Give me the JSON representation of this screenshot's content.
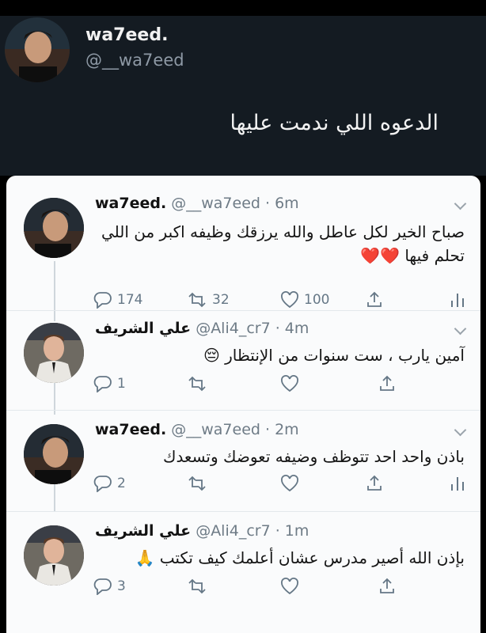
{
  "top": {
    "name": "wa7eed.",
    "handle": "@__wa7eed",
    "text": "الدعوه اللي ندمت عليها"
  },
  "tweets": [
    {
      "name": "wa7eed.",
      "handle": "@__wa7eed · 6m",
      "text": "صباح الخير لكل عاطل والله يرزقك وظيفه  اكبر من اللي تحلم فيها ❤️❤️",
      "reply_count": "174",
      "retweet_count": "32",
      "like_count": "100"
    },
    {
      "name": "علي الشريف",
      "handle": "@Ali4_cr7 · 4m",
      "text": "آمين يارب ، ست سنوات من الإنتظار 😔",
      "reply_count": "1",
      "retweet_count": "",
      "like_count": ""
    },
    {
      "name": "wa7eed.",
      "handle": "@__wa7eed · 2m",
      "text": "باذن واحد احد تتوظف وضيفه تعوضك وتسعدك",
      "reply_count": "2",
      "retweet_count": "",
      "like_count": ""
    },
    {
      "name": "علي الشريف",
      "handle": "@Ali4_cr7 · 1m",
      "text": "بإذن الله أصير مدرس عشان أعلمك كيف تكتب 🙏",
      "reply_count": "3",
      "retweet_count": "",
      "like_count": ""
    }
  ],
  "colors": {
    "header_bg": "#141b22",
    "card_bg": "#fafbfc",
    "icon_gray": "#657786"
  }
}
